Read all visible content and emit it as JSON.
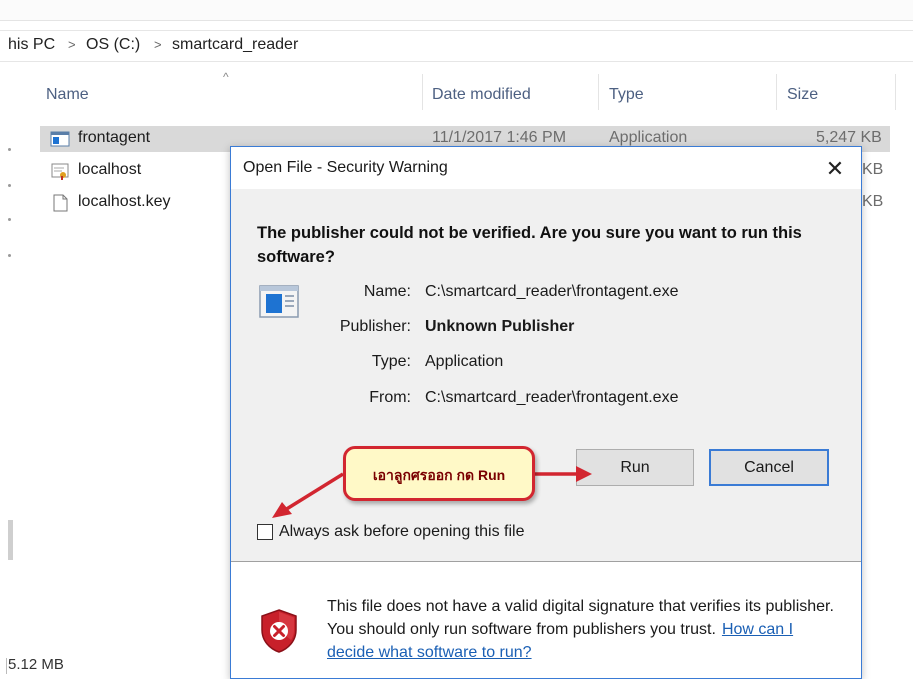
{
  "breadcrumb": {
    "items": [
      "his PC",
      "OS (C:)",
      "smartcard_reader"
    ],
    "separator": ">"
  },
  "columns": {
    "name": "Name",
    "date_modified": "Date modified",
    "type": "Type",
    "size": "Size"
  },
  "files": [
    {
      "name": "frontagent",
      "date": "11/1/2017 1:46 PM",
      "type": "Application",
      "size": "5,247 KB",
      "icon": "application-icon"
    },
    {
      "name": "localhost",
      "size": "KB",
      "icon": "certificate-icon"
    },
    {
      "name": "localhost.key",
      "size": "KB",
      "icon": "file-icon"
    }
  ],
  "status_bar": {
    "size": "5.12 MB"
  },
  "dialog": {
    "title": "Open File - Security Warning",
    "close_glyph": "✕",
    "question": "The publisher could not be verified.  Are you sure you want to run this software?",
    "details": {
      "name_label": "Name:",
      "name_value": "C:\\smartcard_reader\\frontagent.exe",
      "publisher_label": "Publisher:",
      "publisher_value": "Unknown Publisher",
      "type_label": "Type:",
      "type_value": "Application",
      "from_label": "From:",
      "from_value": "C:\\smartcard_reader\\frontagent.exe"
    },
    "run_button": "Run",
    "cancel_button": "Cancel",
    "checkbox_label": "Always ask before opening this file",
    "checkbox_checked": false,
    "warning_text": "This file does not have a valid digital signature that verifies its publisher.  You should only run software from publishers you trust.",
    "warning_link": "How can I decide what software to run?"
  },
  "annotation": {
    "text": "เอาลูกศรออก กด Run",
    "border_color": "#d22630",
    "fill_color": "#fff9c7"
  },
  "colors": {
    "accent": "#3a7bd5",
    "link": "#1a5fb4",
    "selected_row": "#d9d9d9",
    "column_header": "#4d6082"
  }
}
